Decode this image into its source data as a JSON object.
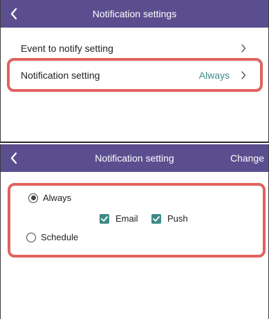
{
  "colors": {
    "header": "#5b4e8f",
    "accent": "#3d8a86",
    "highlight": "#e0625f"
  },
  "screen1": {
    "title": "Notification settings",
    "back_icon": "chevron-left-icon",
    "rows": [
      {
        "label": "Event to notify setting",
        "value": "",
        "icon": "chevron-right-icon"
      },
      {
        "label": "Notification setting",
        "value": "Always",
        "icon": "chevron-right-icon"
      }
    ]
  },
  "screen2": {
    "title": "Notification setting",
    "action_label": "Change",
    "back_icon": "chevron-left-icon",
    "options": [
      {
        "label": "Always",
        "selected": true
      },
      {
        "label": "Schedule",
        "selected": false
      }
    ],
    "channels": [
      {
        "label": "Email",
        "checked": true
      },
      {
        "label": "Push",
        "checked": true
      }
    ]
  }
}
